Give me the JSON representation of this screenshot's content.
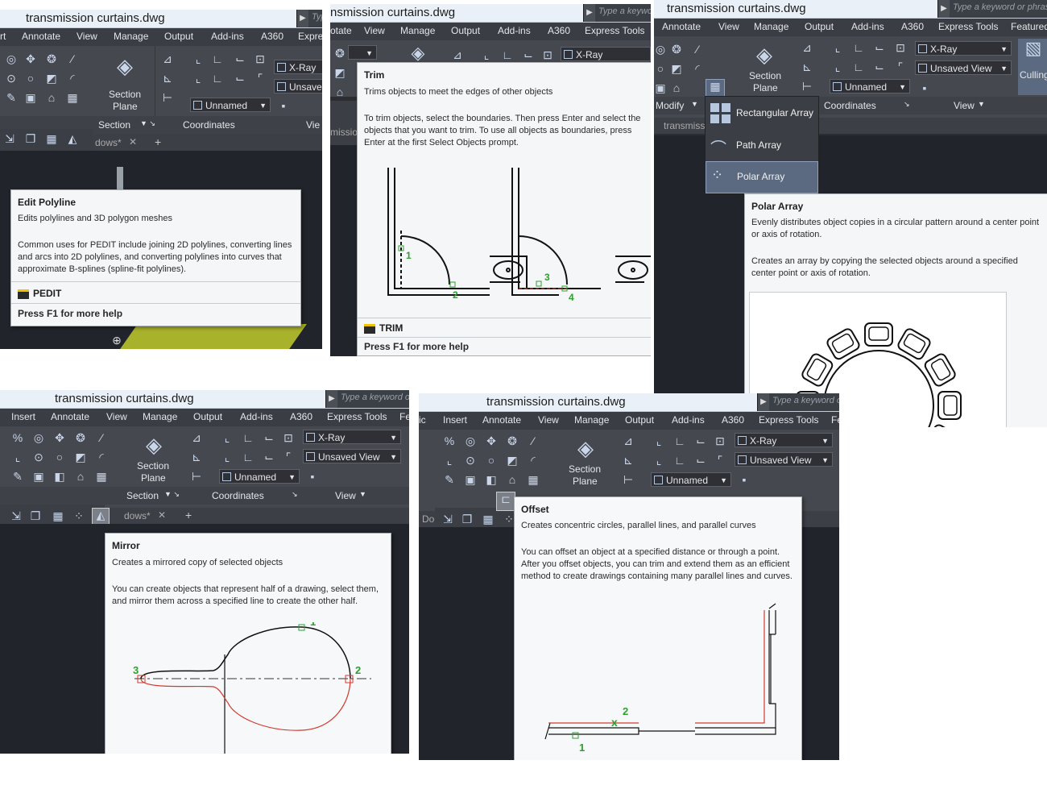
{
  "file_title": "transmission curtains.dwg",
  "search_placeholder": "Type a keyword or phrase",
  "menus": {
    "p1": [
      "rt",
      "Annotate",
      "View",
      "Manage",
      "Output",
      "Add-ins",
      "A360",
      "Expres"
    ],
    "p2": [
      "otate",
      "View",
      "Manage",
      "Output",
      "Add-ins",
      "A360",
      "Express Tools"
    ],
    "p3": [
      "Annotate",
      "View",
      "Manage",
      "Output",
      "Add-ins",
      "A360",
      "Express Tools",
      "Featured"
    ],
    "p4": [
      "Insert",
      "Annotate",
      "View",
      "Manage",
      "Output",
      "Add-ins",
      "A360",
      "Express Tools",
      "Fe"
    ],
    "p5": [
      "ic",
      "Insert",
      "Annotate",
      "View",
      "Manage",
      "Output",
      "Add-ins",
      "A360",
      "Express Tools",
      "Fe"
    ]
  },
  "ribbon": {
    "section_plane": "Section Plane",
    "section_line1": "Section",
    "section_line2": "Plane",
    "section_label": "Section",
    "coordinates": "Coordinates",
    "view": "View",
    "modify": "Modify",
    "xray": "X-Ray",
    "unsaved_view": "Unsaved View",
    "unsaved_short": "Unsave",
    "unnamed": "Unnamed",
    "culling": "Culling",
    "view_short": "Vie"
  },
  "tabs": {
    "p1": "dows*",
    "p2": "missio",
    "p3": "transmiss",
    "p4": "dows*",
    "p5": "Doc"
  },
  "tooltips": {
    "pedit": {
      "title": "Edit Polyline",
      "desc": "Edits polylines and 3D polygon meshes",
      "detail": "Common uses for PEDIT include joining 2D polylines, converting lines and arcs into 2D polylines, and converting polylines into curves that approximate B-splines (spline-fit polylines).",
      "command": "PEDIT",
      "help": "Press F1 for more help"
    },
    "trim": {
      "title": "Trim",
      "desc": "Trims objects to meet the edges of other objects",
      "detail": "To trim objects, select the boundaries. Then press Enter and select the objects that you want to trim. To use all objects as boundaries, press Enter at the first Select Objects prompt.",
      "command": "TRIM",
      "help": "Press F1 for more help",
      "labels": [
        "1",
        "2",
        "3",
        "4"
      ]
    },
    "polar": {
      "title": "Polar Array",
      "desc": "Evenly distributes object copies in a circular pattern around a center point or axis of rotation.",
      "detail": "Creates an array by copying the selected objects around a specified center point or axis of rotation."
    },
    "mirror": {
      "title": "Mirror",
      "desc": "Creates a mirrored copy of selected objects",
      "detail": "You can create objects that represent half of a drawing, select them, and mirror them across a specified line to create the other half.",
      "labels": [
        "1",
        "2",
        "3"
      ]
    },
    "offset": {
      "title": "Offset",
      "desc": "Creates concentric circles, parallel lines, and parallel curves",
      "detail": "You can offset an object at a specified distance or through a point. After you offset objects, you can trim and extend them as an efficient method to create drawings containing many parallel lines and curves.",
      "labels": [
        "1",
        "2"
      ]
    }
  },
  "array_menu": [
    "Rectangular Array",
    "Path Array",
    "Polar Array"
  ],
  "colors": {
    "dark_bg": "#2b2d31",
    "ribbon": "#45484e",
    "title_bg": "#eaf0f7",
    "tooltip_bg": "#f4f6f8",
    "marker_green": "#2da02d",
    "mirror_red": "#d33a2f",
    "highlight": "#5b6a80"
  }
}
